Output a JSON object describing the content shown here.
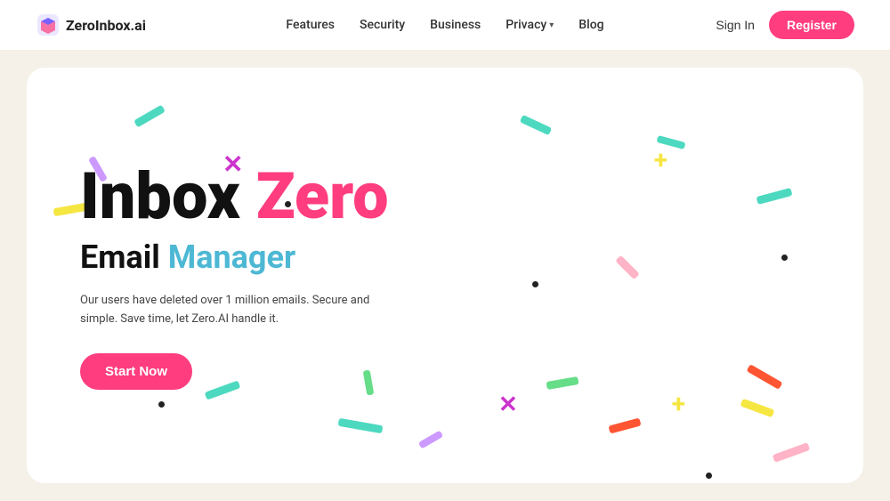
{
  "brand": {
    "name": "ZeroInbox.ai"
  },
  "nav": {
    "links": [
      {
        "label": "Features",
        "id": "features"
      },
      {
        "label": "Security",
        "id": "security"
      },
      {
        "label": "Business",
        "id": "business"
      },
      {
        "label": "Privacy",
        "id": "privacy",
        "hasDropdown": true
      },
      {
        "label": "Blog",
        "id": "blog"
      }
    ],
    "sign_in": "Sign In",
    "register": "Register"
  },
  "hero": {
    "title_part1": "Inbox ",
    "title_part2": "Zero",
    "subtitle_part1": "Email ",
    "subtitle_part2": "Manager",
    "description": "Our users have deleted over 1 million emails. Secure and simple. Save time, let Zero.AI handle it.",
    "cta": "Start Now"
  }
}
